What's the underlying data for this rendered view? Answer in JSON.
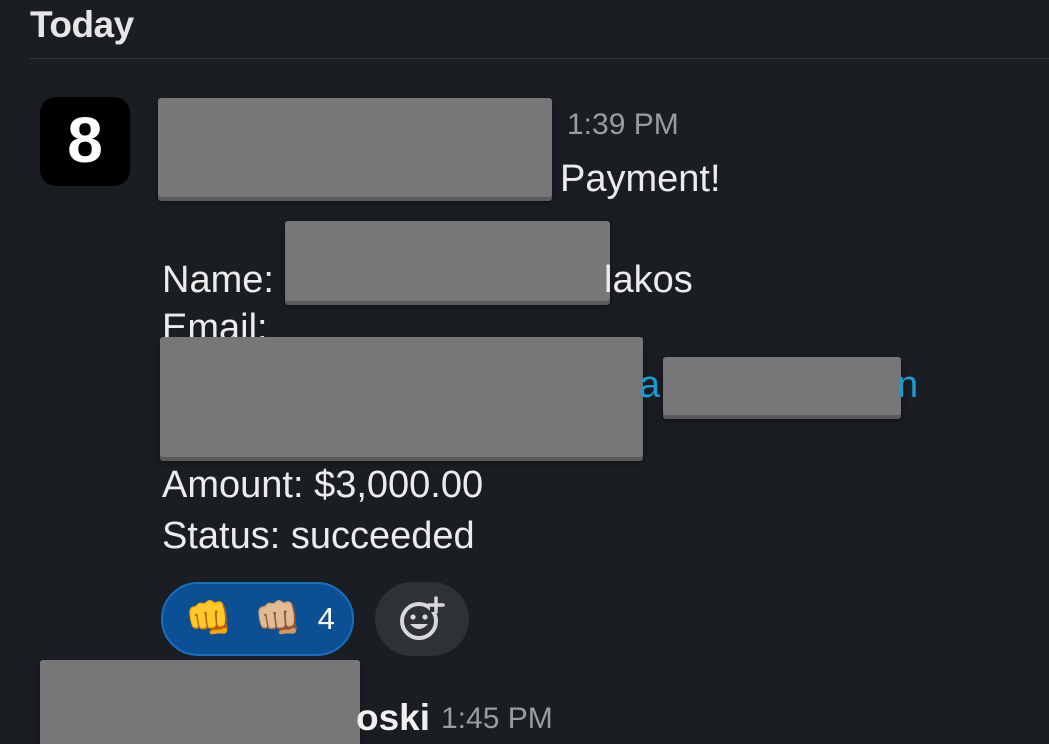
{
  "day_header": "Today",
  "message1": {
    "avatar_glyph": "8",
    "time": "1:39 PM",
    "line_title_end": "Payment!",
    "name_label": "Name:",
    "name_value_end": "lakos",
    "email_label": "Email:",
    "email_fragment_1": "a",
    "email_fragment_2": "n",
    "amount": "Amount: $3,000.00",
    "status": "Status: succeeded",
    "reactions": [
      {
        "emoji": "👊",
        "tone": "👊🏼",
        "count": "4"
      }
    ]
  },
  "message2": {
    "sender_end": "oski",
    "time": "1:45 PM"
  },
  "colors": {
    "background": "#1a1d21",
    "link": "#1d9bd1",
    "reaction_bg": "#0b4f94"
  }
}
